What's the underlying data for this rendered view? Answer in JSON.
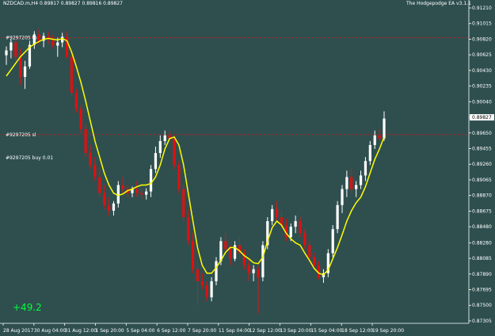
{
  "symbol_line": "NZDCAD.m,H4  0.89817 0.89827 0.89816 0.89827",
  "ea_label": "The Hodgepodge EA  v3.1.1",
  "profit": "+49.2",
  "colors": {
    "background": "#2f4f4f",
    "bull": "#ffffff",
    "bear": "#e01010",
    "ma": "#ffff00",
    "level_line": "#b22222",
    "current_price_bg": "#ffffff",
    "profit": "#00ff3c",
    "axis": "#ffffff"
  },
  "chart_data": {
    "type": "candlestick",
    "title": "",
    "xlabel": "",
    "ylabel": "",
    "ylim": [
      0.87275,
      0.9123
    ],
    "y_ticks": [
      "0.91210",
      "0.91015",
      "0.90820",
      "0.90625",
      "0.90430",
      "0.90235",
      "0.90040",
      "0.89827",
      "0.89650",
      "0.89455",
      "0.89260",
      "0.89065",
      "0.88870",
      "0.88675",
      "0.88480",
      "0.88280",
      "0.88085",
      "0.87890",
      "0.87695",
      "0.87500",
      "0.87305"
    ],
    "y_tick_values": [
      0.9121,
      0.91015,
      0.9082,
      0.90625,
      0.9043,
      0.90235,
      0.9004,
      0.89845,
      0.8965,
      0.89455,
      0.8926,
      0.89065,
      0.8887,
      0.88675,
      0.8848,
      0.8828,
      0.88085,
      0.8789,
      0.87695,
      0.875,
      0.87305
    ],
    "x_ticks": [
      "28 Aug 2017",
      "30 Aug 04:00",
      "31 Aug 12:00",
      "1 Sep 20:00",
      "5 Sep 04:00",
      "6 Sep 12:00",
      "7 Sep 20:00",
      "11 Sep 04:00",
      "12 Sep 12:00",
      "13 Sep 20:00",
      "15 Sep 04:00",
      "18 Sep 12:00",
      "19 Sep 20:00"
    ],
    "current_price": 0.89827,
    "levels": [
      {
        "label": "#9297205 tp",
        "price": 0.9084
      },
      {
        "label": "#9297205 sl",
        "price": 0.8963
      }
    ],
    "order_label": "#9297205 buy 0.01",
    "ohlc": [
      [
        0.9062,
        0.9073,
        0.905,
        0.9068
      ],
      [
        0.9068,
        0.9082,
        0.9058,
        0.9078
      ],
      [
        0.9078,
        0.9084,
        0.9055,
        0.906
      ],
      [
        0.906,
        0.907,
        0.9025,
        0.9035
      ],
      [
        0.9035,
        0.9055,
        0.902,
        0.9048
      ],
      [
        0.9048,
        0.908,
        0.9045,
        0.9075
      ],
      [
        0.9075,
        0.9092,
        0.907,
        0.9088
      ],
      [
        0.9088,
        0.9095,
        0.9075,
        0.908
      ],
      [
        0.908,
        0.909,
        0.9072,
        0.9086
      ],
      [
        0.9086,
        0.9092,
        0.9076,
        0.9082
      ],
      [
        0.9082,
        0.9088,
        0.907,
        0.9074
      ],
      [
        0.9074,
        0.9084,
        0.906,
        0.9078
      ],
      [
        0.9078,
        0.909,
        0.9072,
        0.9085
      ],
      [
        0.9085,
        0.9092,
        0.9058,
        0.906
      ],
      [
        0.906,
        0.9065,
        0.901,
        0.9015
      ],
      [
        0.9015,
        0.902,
        0.899,
        0.8995
      ],
      [
        0.8995,
        0.9,
        0.8965,
        0.897
      ],
      [
        0.897,
        0.8975,
        0.8935,
        0.894
      ],
      [
        0.894,
        0.895,
        0.892,
        0.8925
      ],
      [
        0.8925,
        0.8935,
        0.8905,
        0.891
      ],
      [
        0.891,
        0.892,
        0.8885,
        0.889
      ],
      [
        0.889,
        0.89,
        0.887,
        0.8875
      ],
      [
        0.8875,
        0.8885,
        0.8862,
        0.8868
      ],
      [
        0.8868,
        0.888,
        0.8862,
        0.8877
      ],
      [
        0.8877,
        0.8905,
        0.8872,
        0.89
      ],
      [
        0.89,
        0.891,
        0.8888,
        0.8895
      ],
      [
        0.8895,
        0.89,
        0.8885,
        0.889
      ],
      [
        0.889,
        0.8898,
        0.8885,
        0.8895
      ],
      [
        0.8895,
        0.8905,
        0.8885,
        0.889
      ],
      [
        0.889,
        0.8895,
        0.8882,
        0.8888
      ],
      [
        0.8888,
        0.8896,
        0.8882,
        0.8892
      ],
      [
        0.8892,
        0.8925,
        0.8885,
        0.892
      ],
      [
        0.892,
        0.8948,
        0.8915,
        0.894
      ],
      [
        0.894,
        0.8962,
        0.8934,
        0.8955
      ],
      [
        0.8955,
        0.8968,
        0.895,
        0.8962
      ],
      [
        0.8962,
        0.8968,
        0.8955,
        0.8958
      ],
      [
        0.8958,
        0.8962,
        0.892,
        0.8925
      ],
      [
        0.8925,
        0.893,
        0.889,
        0.8895
      ],
      [
        0.8895,
        0.89,
        0.8855,
        0.886
      ],
      [
        0.886,
        0.887,
        0.8825,
        0.883
      ],
      [
        0.883,
        0.884,
        0.879,
        0.8795
      ],
      [
        0.8795,
        0.8805,
        0.875,
        0.878
      ],
      [
        0.878,
        0.879,
        0.877,
        0.8775
      ],
      [
        0.8775,
        0.878,
        0.8755,
        0.876
      ],
      [
        0.876,
        0.8785,
        0.8755,
        0.878
      ],
      [
        0.878,
        0.881,
        0.8775,
        0.8805
      ],
      [
        0.8805,
        0.8835,
        0.88,
        0.883
      ],
      [
        0.883,
        0.884,
        0.8815,
        0.882
      ],
      [
        0.882,
        0.8825,
        0.88,
        0.8808
      ],
      [
        0.8808,
        0.883,
        0.8805,
        0.8825
      ],
      [
        0.8825,
        0.8835,
        0.881,
        0.8815
      ],
      [
        0.8815,
        0.882,
        0.8795,
        0.88
      ],
      [
        0.88,
        0.881,
        0.878,
        0.879
      ],
      [
        0.879,
        0.88,
        0.878,
        0.8795
      ],
      [
        0.8795,
        0.88,
        0.874,
        0.8785
      ],
      [
        0.8785,
        0.883,
        0.878,
        0.8825
      ],
      [
        0.8825,
        0.886,
        0.882,
        0.8855
      ],
      [
        0.8855,
        0.8875,
        0.885,
        0.887
      ],
      [
        0.887,
        0.888,
        0.8855,
        0.886
      ],
      [
        0.886,
        0.8868,
        0.8845,
        0.885
      ],
      [
        0.885,
        0.8858,
        0.883,
        0.8835
      ],
      [
        0.8835,
        0.8852,
        0.883,
        0.8848
      ],
      [
        0.8848,
        0.8862,
        0.884,
        0.8855
      ],
      [
        0.8855,
        0.886,
        0.8835,
        0.884
      ],
      [
        0.884,
        0.8845,
        0.882,
        0.8825
      ],
      [
        0.8825,
        0.883,
        0.8805,
        0.881
      ],
      [
        0.881,
        0.8815,
        0.8795,
        0.88
      ],
      [
        0.88,
        0.8805,
        0.8782,
        0.8785
      ],
      [
        0.8785,
        0.8795,
        0.8778,
        0.879
      ],
      [
        0.879,
        0.882,
        0.8785,
        0.8815
      ],
      [
        0.8815,
        0.885,
        0.881,
        0.8845
      ],
      [
        0.8845,
        0.888,
        0.884,
        0.8875
      ],
      [
        0.8875,
        0.89,
        0.8865,
        0.8895
      ],
      [
        0.8895,
        0.8918,
        0.8885,
        0.891
      ],
      [
        0.891,
        0.892,
        0.889,
        0.8895
      ],
      [
        0.8895,
        0.8905,
        0.8885,
        0.89
      ],
      [
        0.89,
        0.8918,
        0.8895,
        0.8912
      ],
      [
        0.8912,
        0.8935,
        0.8905,
        0.893
      ],
      [
        0.893,
        0.8955,
        0.8925,
        0.895
      ],
      [
        0.895,
        0.8968,
        0.8945,
        0.8962
      ],
      [
        0.8962,
        0.897,
        0.8955,
        0.8958
      ],
      [
        0.8958,
        0.8992,
        0.8955,
        0.8983
      ]
    ],
    "ma": [
      0.9036,
      0.9044,
      0.9052,
      0.906,
      0.9066,
      0.9072,
      0.9076,
      0.9079,
      0.9082,
      0.9083,
      0.9082,
      0.9081,
      0.9083,
      0.908,
      0.9066,
      0.9048,
      0.9028,
      0.9005,
      0.898,
      0.8955,
      0.8935,
      0.8915,
      0.89,
      0.889,
      0.8887,
      0.8889,
      0.8893,
      0.8895,
      0.8898,
      0.89,
      0.89,
      0.8902,
      0.891,
      0.8925,
      0.8945,
      0.8958,
      0.896,
      0.895,
      0.8925,
      0.889,
      0.8855,
      0.8822,
      0.88,
      0.879,
      0.879,
      0.8797,
      0.8806,
      0.8816,
      0.8822,
      0.8822,
      0.8818,
      0.8812,
      0.8808,
      0.8803,
      0.8802,
      0.881,
      0.883,
      0.8847,
      0.8855,
      0.885,
      0.884,
      0.8833,
      0.8828,
      0.8825,
      0.8815,
      0.8806,
      0.8796,
      0.879,
      0.8788,
      0.8794,
      0.8808,
      0.8822,
      0.8838,
      0.8855,
      0.8868,
      0.8878,
      0.8885,
      0.8898,
      0.8915,
      0.8932,
      0.8945,
      0.896
    ]
  }
}
